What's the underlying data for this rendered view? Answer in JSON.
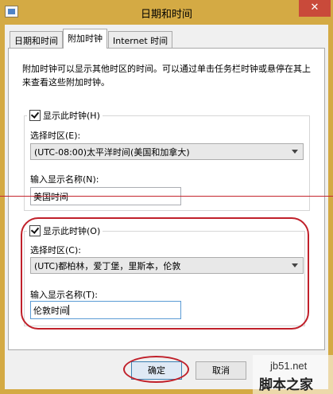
{
  "window": {
    "title": "日期和时间",
    "close_glyph": "✕"
  },
  "tabs": [
    {
      "label": "日期和时间",
      "active": false
    },
    {
      "label": "附加时钟",
      "active": true
    },
    {
      "label": "Internet 时间",
      "active": false
    }
  ],
  "description": "附加时钟可以显示其他时区的时间。可以通过单击任务栏时钟或悬停在其上来查看这些附加时钟。",
  "clock1": {
    "checkbox_label": "显示此时钟(H)",
    "checked": true,
    "timezone_label": "选择时区(E):",
    "timezone_value": "(UTC-08:00)太平洋时间(美国和加拿大)",
    "name_label": "输入显示名称(N):",
    "name_value": "美国时间"
  },
  "clock2": {
    "checkbox_label": "显示此时钟(O)",
    "checked": true,
    "timezone_label": "选择时区(C):",
    "timezone_value": "(UTC)都柏林，爱丁堡，里斯本，伦敦",
    "name_label": "输入显示名称(T):",
    "name_value": "伦敦时间"
  },
  "buttons": {
    "ok": "确定",
    "cancel": "取消"
  },
  "watermark": {
    "site": "jb51.net",
    "brand": "脚本之家"
  },
  "colors": {
    "title_bar": "#d4aa44",
    "annotation_red": "#c0202a"
  }
}
